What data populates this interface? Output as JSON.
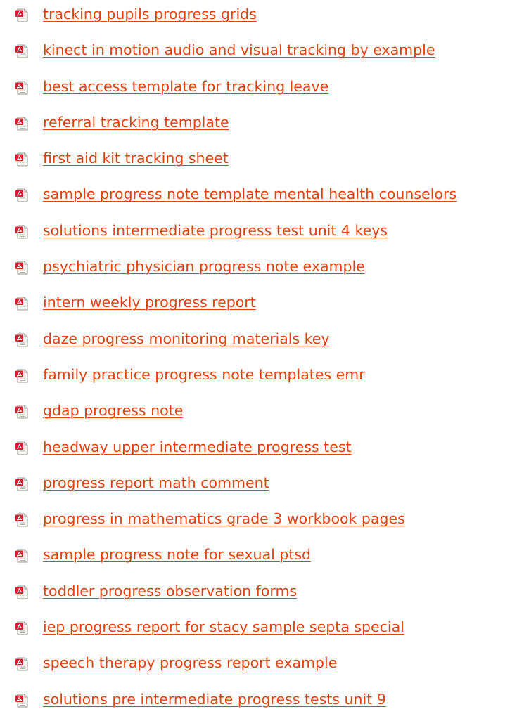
{
  "icon": "pdf-document-icon",
  "colors": {
    "link": "#e3420e",
    "icon_red": "#d4202a",
    "icon_paper": "#f2f2ee"
  },
  "documents": [
    {
      "title": "tracking pupils progress grids"
    },
    {
      "title": "kinect in motion audio and visual tracking by example"
    },
    {
      "title": "best access template for tracking leave"
    },
    {
      "title": "referral tracking template"
    },
    {
      "title": "first aid kit tracking sheet"
    },
    {
      "title": "sample progress note template mental health counselors"
    },
    {
      "title": "solutions intermediate progress test unit 4 keys"
    },
    {
      "title": "psychiatric physician progress note example"
    },
    {
      "title": "intern weekly progress report"
    },
    {
      "title": "daze progress monitoring materials key"
    },
    {
      "title": "family practice progress note templates emr"
    },
    {
      "title": "gdap progress note"
    },
    {
      "title": "headway upper intermediate progress test"
    },
    {
      "title": "progress report math comment"
    },
    {
      "title": "progress in mathematics grade 3 workbook pages"
    },
    {
      "title": "sample progress note for sexual ptsd"
    },
    {
      "title": "toddler progress observation forms"
    },
    {
      "title": "iep progress report for stacy sample septa special"
    },
    {
      "title": "speech therapy progress report example"
    },
    {
      "title": "solutions pre intermediate progress tests unit 9"
    }
  ]
}
